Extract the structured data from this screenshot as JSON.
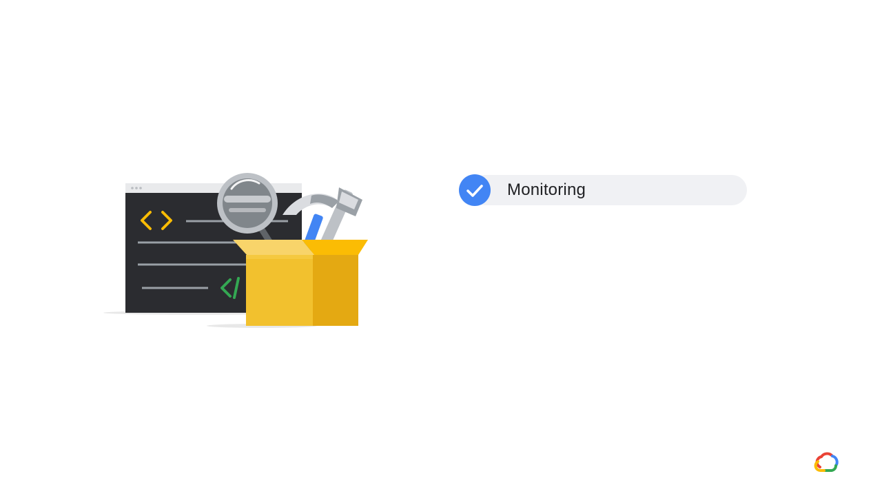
{
  "checklist": {
    "items": [
      {
        "label": "Monitoring",
        "checked": true
      }
    ],
    "check_color": "#4285f4",
    "pill_color": "#f0f1f4"
  },
  "illustration": {
    "icons": [
      "code-window-icon",
      "magnifying-glass-icon",
      "hammer-icon",
      "wrench-icon",
      "toolbox-icon"
    ]
  },
  "logo": {
    "icon": "google-cloud-logo-icon",
    "colors": [
      "#ea4335",
      "#fbbc04",
      "#34a853",
      "#4285f4"
    ]
  }
}
